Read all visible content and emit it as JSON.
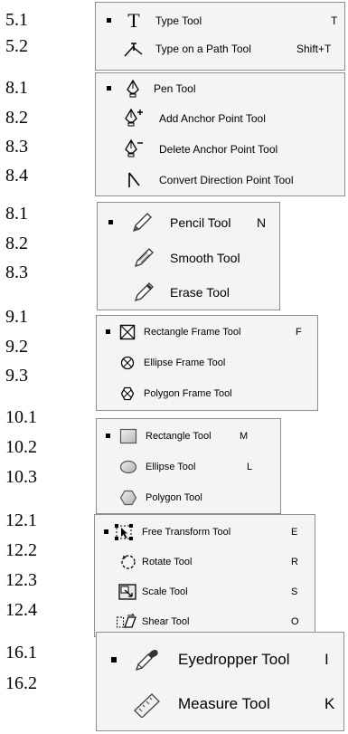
{
  "numbers": [
    "5.1",
    "5.2",
    "8.1",
    "8.2",
    "8.3",
    "8.4",
    "8.1",
    "8.2",
    "8.3",
    "9.1",
    "9.2",
    "9.3",
    "10.1",
    "10.2",
    "10.3",
    "12.1",
    "12.2",
    "12.3",
    "12.4",
    "16.1",
    "16.2"
  ],
  "groups": [
    {
      "items": [
        {
          "label": "Type Tool",
          "key": "T",
          "icon": "type-icon",
          "selected": true
        },
        {
          "label": "Type on a Path Tool",
          "key": "Shift+T",
          "icon": "type-on-path-icon",
          "selected": false
        }
      ]
    },
    {
      "items": [
        {
          "label": "Pen Tool",
          "key": "",
          "icon": "pen-icon",
          "selected": true
        },
        {
          "label": "Add Anchor Point Tool",
          "key": "",
          "icon": "add-anchor-icon",
          "selected": false
        },
        {
          "label": "Delete Anchor Point Tool",
          "key": "",
          "icon": "delete-anchor-icon",
          "selected": false
        },
        {
          "label": "Convert Direction Point Tool",
          "key": "",
          "icon": "convert-direction-icon",
          "selected": false
        }
      ]
    },
    {
      "items": [
        {
          "label": "Pencil Tool",
          "key": "N",
          "icon": "pencil-icon",
          "selected": true
        },
        {
          "label": "Smooth Tool",
          "key": "",
          "icon": "smooth-icon",
          "selected": false
        },
        {
          "label": "Erase Tool",
          "key": "",
          "icon": "erase-icon",
          "selected": false
        }
      ]
    },
    {
      "items": [
        {
          "label": "Rectangle Frame Tool",
          "key": "F",
          "icon": "rectangle-frame-icon",
          "selected": true
        },
        {
          "label": "Ellipse Frame Tool",
          "key": "",
          "icon": "ellipse-frame-icon",
          "selected": false
        },
        {
          "label": "Polygon Frame Tool",
          "key": "",
          "icon": "polygon-frame-icon",
          "selected": false
        }
      ]
    },
    {
      "items": [
        {
          "label": "Rectangle Tool",
          "key": "M",
          "icon": "rectangle-icon",
          "selected": true
        },
        {
          "label": "Ellipse Tool",
          "key": "L",
          "icon": "ellipse-icon",
          "selected": false
        },
        {
          "label": "Polygon Tool",
          "key": "",
          "icon": "polygon-icon",
          "selected": false
        }
      ]
    },
    {
      "items": [
        {
          "label": "Free Transform Tool",
          "key": "E",
          "icon": "free-transform-icon",
          "selected": true
        },
        {
          "label": "Rotate Tool",
          "key": "R",
          "icon": "rotate-icon",
          "selected": false
        },
        {
          "label": "Scale Tool",
          "key": "S",
          "icon": "scale-icon",
          "selected": false
        },
        {
          "label": "Shear Tool",
          "key": "O",
          "icon": "shear-icon",
          "selected": false
        }
      ]
    },
    {
      "items": [
        {
          "label": "Eyedropper Tool",
          "key": "I",
          "icon": "eyedropper-icon",
          "selected": true
        },
        {
          "label": "Measure Tool",
          "key": "K",
          "icon": "measure-icon",
          "selected": false
        }
      ]
    }
  ]
}
